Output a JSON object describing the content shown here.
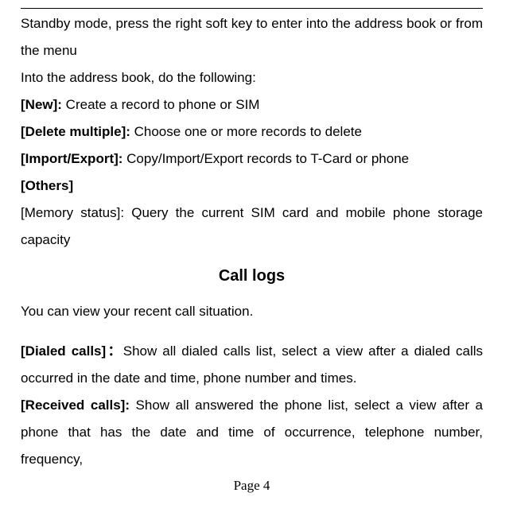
{
  "doc": {
    "intro1": "Standby mode, press the right soft key to enter into the address book or from the menu",
    "intro2": "Into the address book, do the following:",
    "new_label": "[New]: ",
    "new_text": "Create a record to phone or SIM",
    "deletemulti_label": "[Delete multiple]: ",
    "deletemulti_text": "Choose one or more records to delete",
    "importexport_label": "[Import/Export]: ",
    "importexport_text": "Copy/Import/Export records to T-Card or phone",
    "others_label": "[Others]",
    "memory_text": "[Memory status]: Query the current SIM card and mobile phone storage capacity",
    "heading": "Call logs",
    "calllogs_intro": "You can view your recent call situation.",
    "dialed_label": " [Dialed calls]：",
    "dialed_text": "Show all dialed calls list, select a view after a dialed calls occurred in the date and time, phone number and times.",
    "received_label": "[Received calls]: ",
    "received_text": "Show all answered the phone list, select a view after a phone that has the date and time of occurrence, telephone number, frequency,",
    "page": "Page 4"
  }
}
